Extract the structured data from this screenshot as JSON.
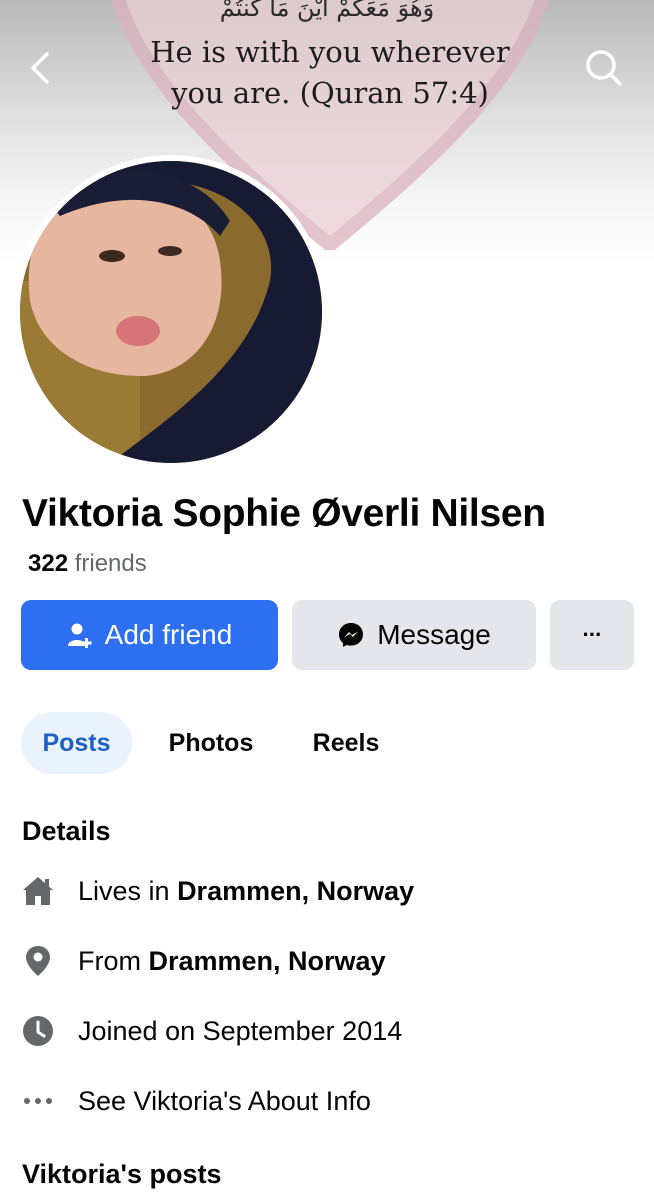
{
  "cover": {
    "arabic_text": "وَهُوَ مَعَكُمْ أَيْنَ مَا كُنتُمْ",
    "quote_line1": "He is with you wherever",
    "quote_line2": "you are. (Quran 57:4)"
  },
  "nav": {
    "back_icon": "chevron-left-icon",
    "search_icon": "search-icon"
  },
  "profile": {
    "name": "Viktoria Sophie Øverli Nilsen",
    "friend_count": "322",
    "friends_label": "friends"
  },
  "actions": {
    "add_friend": "Add friend",
    "message": "Message",
    "more": "···"
  },
  "tabs": [
    {
      "label": "Posts",
      "active": true
    },
    {
      "label": "Photos",
      "active": false
    },
    {
      "label": "Reels",
      "active": false
    }
  ],
  "details": {
    "title": "Details",
    "lives_prefix": "Lives in ",
    "lives_value": "Drammen, Norway",
    "from_prefix": "From ",
    "from_value": "Drammen, Norway",
    "joined": "Joined on September 2014",
    "about": "See Viktoria's About Info"
  },
  "posts_title": "Viktoria's posts",
  "colors": {
    "primary": "#2d6ff0",
    "tab_active_bg": "#eaf2fc",
    "tab_active_text": "#1f5fc6",
    "secondary_button": "#e4e6eb"
  }
}
